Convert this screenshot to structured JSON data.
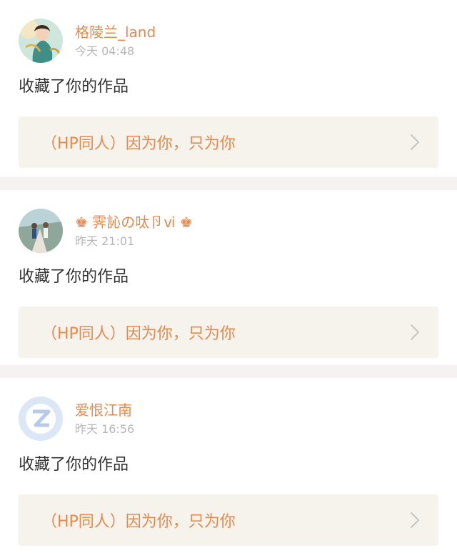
{
  "feed": [
    {
      "username": "格陵兰_land",
      "time": "今天 04:48",
      "action": "收藏了你的作品",
      "work_title": "（HP同人）因为你，只为你",
      "avatar_icon": "illustrated-character-avatar"
    },
    {
      "username": "♚ 霁訫の呔卪ⅵ ♚",
      "time": "昨天 21:01",
      "action": "收藏了你的作品",
      "work_title": "（HP同人）因为你，只为你",
      "avatar_icon": "photo-couple-avatar"
    },
    {
      "username": "爱恨江南",
      "time": "昨天 16:56",
      "action": "收藏了你的作品",
      "work_title": "（HP同人）因为你，只为你",
      "avatar_icon": "default-qzone-avatar"
    }
  ],
  "colors": {
    "accent": "#e58a4e",
    "time": "#b7b7b7",
    "link_bg": "#f5f3ec",
    "page_bg": "#f6f2f2"
  }
}
